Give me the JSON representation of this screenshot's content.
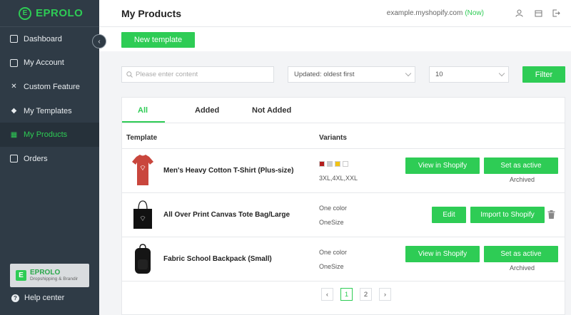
{
  "app": {
    "logo_text": "EPROLO",
    "logo_mark": "E"
  },
  "sidebar": {
    "items": [
      {
        "label": "Dashboard",
        "icon": "dashboard-icon"
      },
      {
        "label": "My Account",
        "icon": "account-icon"
      },
      {
        "label": "Custom Feature",
        "icon": "tools-icon"
      },
      {
        "label": "My Templates",
        "icon": "cube-icon"
      },
      {
        "label": "My Products",
        "icon": "products-icon",
        "active": true
      },
      {
        "label": "Orders",
        "icon": "orders-icon"
      }
    ],
    "brand_name": "EPROLO",
    "brand_sub": "Dropshipping & Brandir",
    "help_label": "Help center"
  },
  "header": {
    "title": "My Products",
    "shop_url": "example.myshopify.com",
    "shop_status": "(Now)"
  },
  "toolbar": {
    "new_template_label": "New template"
  },
  "filters": {
    "search_placeholder": "Please enter content",
    "sort_value": "Updated: oldest first",
    "page_size_value": "10",
    "filter_label": "Filter"
  },
  "tabs": [
    {
      "label": "All",
      "active": true
    },
    {
      "label": "Added"
    },
    {
      "label": "Not Added"
    }
  ],
  "table": {
    "col_template": "Template",
    "col_variants": "Variants",
    "rows": [
      {
        "name": "Men's Heavy Cotton T-Shirt (Plus-size)",
        "swatch_colors": [
          "#b31d1d",
          "#c9cdd1",
          "#f2c313",
          "#ffffff"
        ],
        "variant_line": "3XL,4XL,XXL",
        "btn_primary": "View in Shopify",
        "btn_secondary": "Set as active",
        "status": "Archived"
      },
      {
        "name": "All Over Print Canvas Tote Bag/Large",
        "variant_line1": "One color",
        "variant_line2": "OneSize",
        "btn_primary": "Edit",
        "btn_secondary": "Import to Shopify"
      },
      {
        "name": "Fabric School Backpack (Small)",
        "variant_line1": "One color",
        "variant_line2": "OneSize",
        "btn_primary": "View in Shopify",
        "btn_secondary": "Set as active",
        "status": "Archived"
      }
    ]
  },
  "pagination": {
    "prev": "‹",
    "next": "›",
    "pages": [
      "1",
      "2"
    ],
    "current": "1"
  },
  "colors": {
    "accent": "#2ecc55",
    "sidebar_bg": "#2f3b46"
  }
}
